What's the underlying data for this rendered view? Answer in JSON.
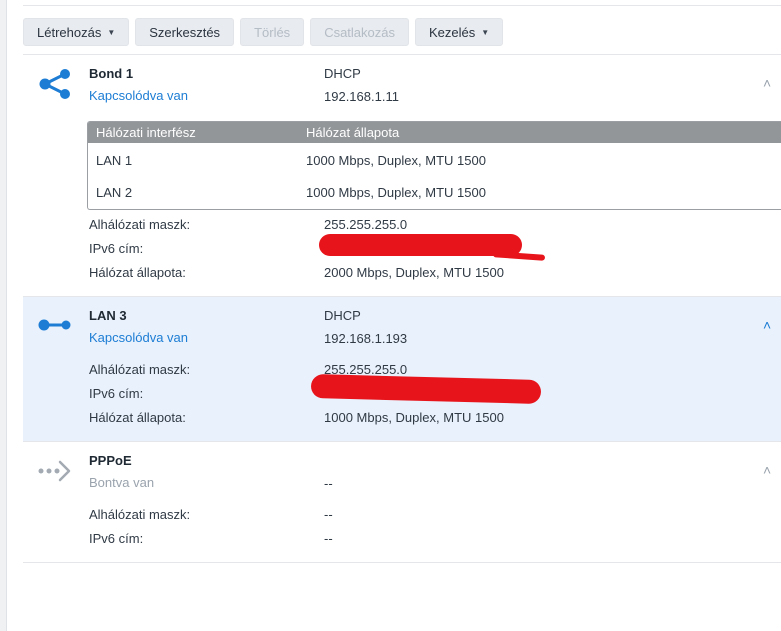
{
  "toolbar": {
    "create": "Létrehozás",
    "edit": "Szerkesztés",
    "delete": "Törlés",
    "connect": "Csatlakozás",
    "manage": "Kezelés"
  },
  "labels": {
    "subnet": "Alhálózati maszk:",
    "ipv6": "IPv6 cím:",
    "state": "Hálózat állapota:"
  },
  "bond": {
    "name": "Bond 1",
    "status": "Kapcsolódva van",
    "mode": "DHCP",
    "ip": "192.168.1.11",
    "subnet": "255.255.255.0",
    "network_state": "2000 Mbps, Duplex, MTU 1500",
    "table": {
      "headers": [
        "Hálózati interfész",
        "Hálózat állapota"
      ],
      "rows": [
        [
          "LAN 1",
          "1000 Mbps, Duplex, MTU 1500"
        ],
        [
          "LAN 2",
          "1000 Mbps, Duplex, MTU 1500"
        ]
      ]
    }
  },
  "lan3": {
    "name": "LAN 3",
    "status": "Kapcsolódva van",
    "mode": "DHCP",
    "ip": "192.168.1.193",
    "subnet": "255.255.255.0",
    "network_state": "1000 Mbps, Duplex, MTU 1500"
  },
  "pppoe": {
    "name": "PPPoE",
    "status": "Bontva van",
    "mode": "--",
    "subnet": "--",
    "ipv6": "--"
  },
  "colors": {
    "accent": "#1d7dd4",
    "selected_bg": "#e8f1fc",
    "redaction": "#e8141b"
  }
}
